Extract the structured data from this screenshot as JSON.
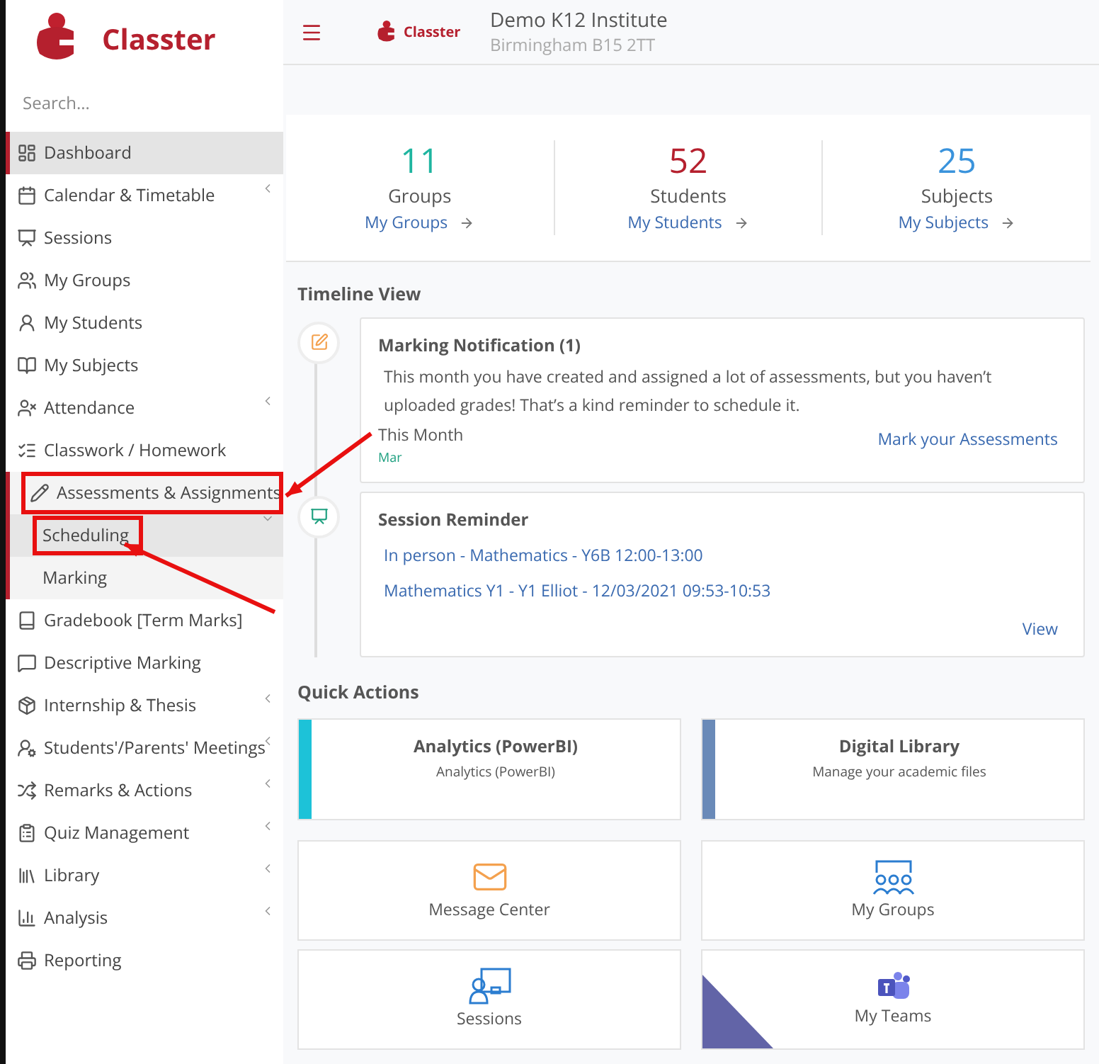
{
  "sidebar": {
    "logo_text": "Classter",
    "search": {
      "placeholder": "Search..."
    },
    "items": [
      {
        "label": "Dashboard",
        "selected": true,
        "has_submenu": false,
        "expanded": false,
        "highlighted": false
      },
      {
        "label": "Calendar & Timetable",
        "selected": false,
        "has_submenu": true,
        "expanded": false,
        "highlighted": false
      },
      {
        "label": "Sessions",
        "selected": false,
        "has_submenu": false,
        "expanded": false,
        "highlighted": false
      },
      {
        "label": "My Groups",
        "selected": false,
        "has_submenu": false,
        "expanded": false,
        "highlighted": false
      },
      {
        "label": "My Students",
        "selected": false,
        "has_submenu": false,
        "expanded": false,
        "highlighted": false
      },
      {
        "label": "My Subjects",
        "selected": false,
        "has_submenu": false,
        "expanded": false,
        "highlighted": false
      },
      {
        "label": "Attendance",
        "selected": false,
        "has_submenu": true,
        "expanded": false,
        "highlighted": false
      },
      {
        "label": "Classwork / Homework",
        "selected": false,
        "has_submenu": false,
        "expanded": false,
        "highlighted": false
      },
      {
        "label": "Assessments & Assignments",
        "selected": false,
        "has_submenu": true,
        "expanded": true,
        "highlighted": true,
        "children": [
          {
            "label": "Scheduling",
            "selected": true,
            "highlighted": true
          },
          {
            "label": "Marking",
            "selected": false,
            "highlighted": false
          }
        ]
      },
      {
        "label": "Gradebook [Term Marks]",
        "selected": false,
        "has_submenu": false,
        "expanded": false,
        "highlighted": false
      },
      {
        "label": "Descriptive Marking",
        "selected": false,
        "has_submenu": false,
        "expanded": false,
        "highlighted": false
      },
      {
        "label": "Internship & Thesis",
        "selected": false,
        "has_submenu": true,
        "expanded": false,
        "highlighted": false
      },
      {
        "label": "Students'/Parents' Meetings",
        "selected": false,
        "has_submenu": true,
        "expanded": false,
        "highlighted": false
      },
      {
        "label": "Remarks & Actions",
        "selected": false,
        "has_submenu": true,
        "expanded": false,
        "highlighted": false
      },
      {
        "label": "Quiz Management",
        "selected": false,
        "has_submenu": true,
        "expanded": false,
        "highlighted": false
      },
      {
        "label": "Library",
        "selected": false,
        "has_submenu": true,
        "expanded": false,
        "highlighted": false
      },
      {
        "label": "Analysis",
        "selected": false,
        "has_submenu": true,
        "expanded": false,
        "highlighted": false
      },
      {
        "label": "Reporting",
        "selected": false,
        "has_submenu": false,
        "expanded": false,
        "highlighted": false
      }
    ]
  },
  "header": {
    "logo_text": "Classter",
    "institute": "Demo K12 Institute",
    "address": "Birmingham B15 2TT"
  },
  "stats": [
    {
      "count": "11",
      "label": "Groups",
      "link": "My Groups",
      "color": "#1fb5a0"
    },
    {
      "count": "52",
      "label": "Students",
      "link": "My Students",
      "color": "#b5202e"
    },
    {
      "count": "25",
      "label": "Subjects",
      "link": "My Subjects",
      "color": "#3a93dc"
    }
  ],
  "timeline": {
    "title": "Timeline View",
    "entries": [
      {
        "kind": "marking",
        "title": "Marking Notification (1)",
        "body": "This month you have created and assigned a lot of assessments, but you haven’t uploaded grades! That’s a kind reminder to schedule it.",
        "date": "This Month",
        "month": "Mar",
        "action": "Mark your Assessments"
      },
      {
        "kind": "session",
        "title": "Session Reminder",
        "lines": [
          "In person - Mathematics - Y6B 12:00-13:00",
          "Mathematics Y1 - Y1 Elliot - 12/03/2021 09:53-10:53"
        ],
        "action": "View"
      }
    ]
  },
  "quick_actions": {
    "title": "Quick Actions",
    "items": [
      {
        "kind": "banner",
        "title": "Analytics (PowerBI)",
        "subtitle": "Analytics (PowerBI)",
        "color": "#1dc2d8"
      },
      {
        "kind": "banner",
        "title": "Digital Library",
        "subtitle": "Manage your academic files",
        "color": "#6a8ab8"
      },
      {
        "kind": "icon",
        "label": "Message Center"
      },
      {
        "kind": "icon",
        "label": "My Groups"
      },
      {
        "kind": "icon",
        "label": "Sessions"
      },
      {
        "kind": "icon",
        "label": "My Teams"
      }
    ]
  }
}
